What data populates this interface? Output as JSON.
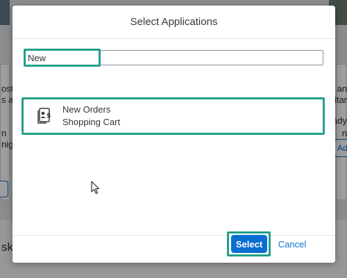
{
  "background": {
    "left_lines": [
      "ost",
      "s a",
      "n",
      "nig"
    ],
    "right_lines": [
      "an",
      "itar",
      "ady",
      "n"
    ],
    "right_button_label": "Add",
    "bottom_left_text": "sk"
  },
  "dialog": {
    "title": "Select Applications",
    "search": {
      "value": "New",
      "placeholder": ""
    },
    "items": [
      {
        "title": "New Orders",
        "subtitle": "Shopping Cart",
        "icon": "shopping-cart-document-icon"
      }
    ],
    "footer": {
      "select_label": "Select",
      "cancel_label": "Cancel"
    }
  },
  "colors": {
    "accent": "#0a6ed1",
    "highlight": "#1fa189"
  }
}
